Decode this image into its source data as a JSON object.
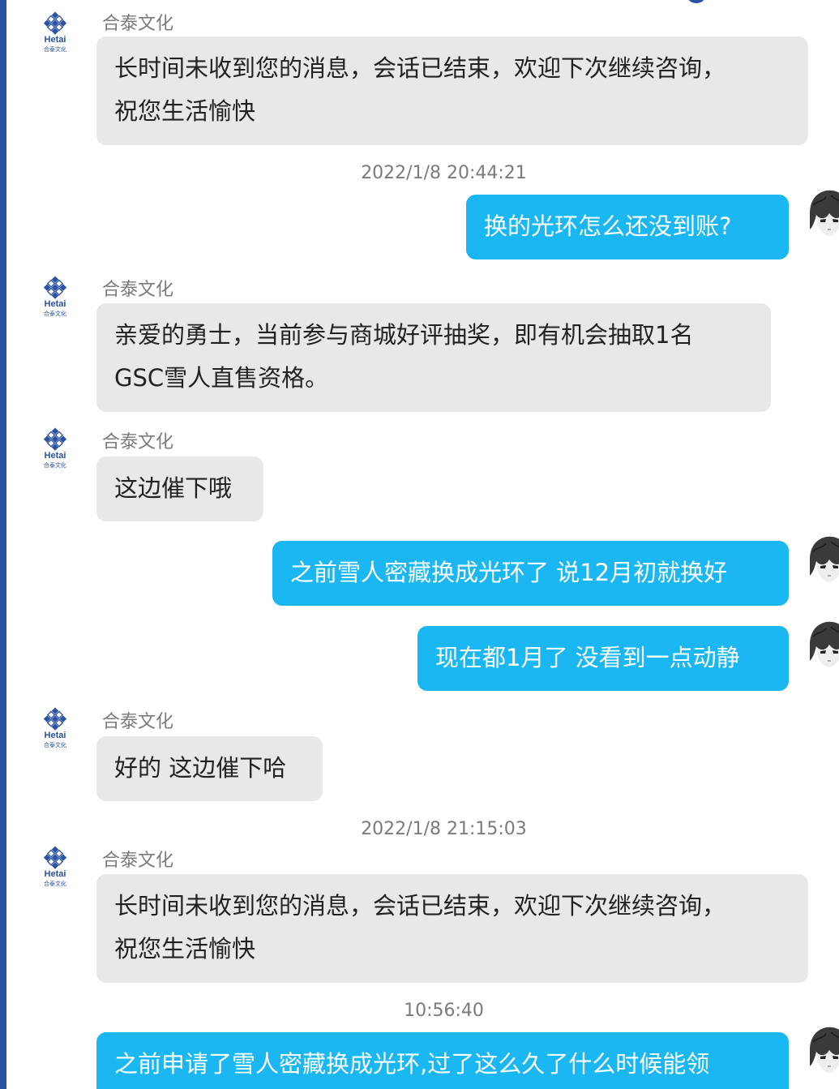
{
  "brand": {
    "logo_text": "Hetai",
    "logo_subtext": "合泰文化",
    "accent": "#1ab7f2",
    "incoming_bg": "#e8e8e8"
  },
  "messages": [
    {
      "type": "incoming",
      "sender": "合泰文化",
      "lines": [
        "长时间未收到您的消息，会话已结束，欢迎下次继续咨询，",
        "祝您生活愉快"
      ]
    },
    {
      "type": "timestamp",
      "text": "2022/1/8 20:44:21"
    },
    {
      "type": "outgoing",
      "lines": [
        "换的光环怎么还没到账?"
      ]
    },
    {
      "type": "incoming",
      "sender": "合泰文化",
      "lines": [
        "亲爱的勇士，当前参与商城好评抽奖，即有机会抽取1名",
        "GSC雪人直售资格。"
      ]
    },
    {
      "type": "incoming",
      "sender": "合泰文化",
      "lines": [
        "这边催下哦"
      ]
    },
    {
      "type": "outgoing",
      "lines": [
        "之前雪人密藏换成光环了 说12月初就换好"
      ]
    },
    {
      "type": "outgoing",
      "lines": [
        "现在都1月了 没看到一点动静"
      ]
    },
    {
      "type": "incoming",
      "sender": "合泰文化",
      "lines": [
        "好的 这边催下哈"
      ]
    },
    {
      "type": "timestamp",
      "text": "2022/1/8 21:15:03"
    },
    {
      "type": "incoming",
      "sender": "合泰文化",
      "lines": [
        "长时间未收到您的消息，会话已结束，欢迎下次继续咨询，",
        "祝您生活愉快"
      ]
    },
    {
      "type": "timestamp",
      "text": "10:56:40"
    },
    {
      "type": "outgoing",
      "lines": [
        "之前申请了雪人密藏换成光环,过了这么久了什么时候能领"
      ]
    }
  ]
}
